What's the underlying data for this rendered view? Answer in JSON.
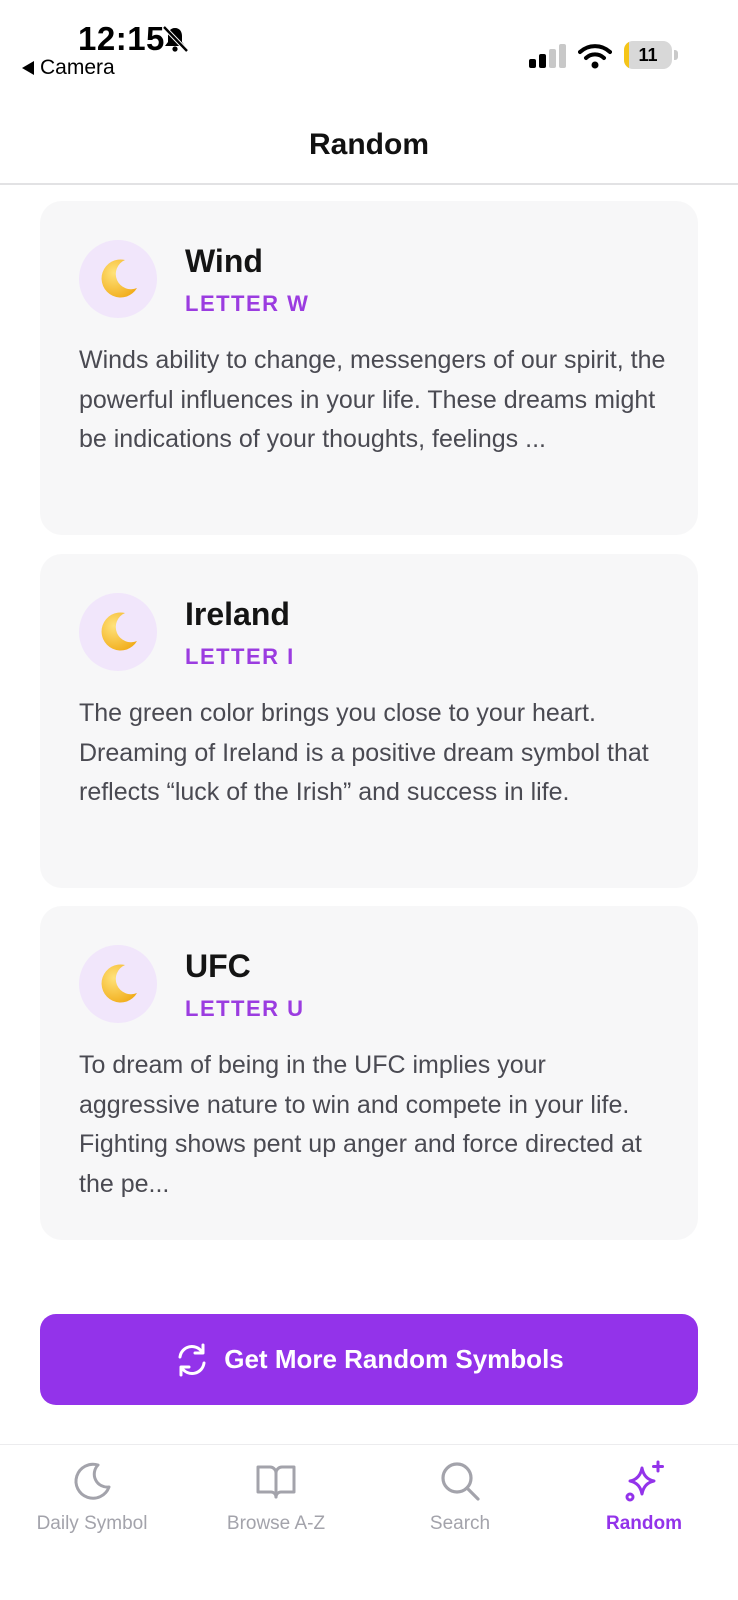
{
  "status": {
    "time": "12:15",
    "back_label": "Camera",
    "battery_text": "11",
    "battery_level": 0.11
  },
  "header": {
    "title": "Random"
  },
  "cards": [
    {
      "title": "Wind",
      "letter": "LETTER W",
      "description": "Winds ability to change, messengers of our spirit, the powerful influences in your life. These dreams might be indications of your thoughts, feelings ...",
      "icon": "crescent-moon-icon"
    },
    {
      "title": "Ireland",
      "letter": "LETTER I",
      "description": "The green color brings you close to your heart. Dreaming of Ireland is a positive dream symbol that reflects “luck of the Irish” and success in life.",
      "icon": "crescent-moon-icon"
    },
    {
      "title": "UFC",
      "letter": "LETTER U",
      "description": "To dream of being in the UFC implies your aggressive nature to win and compete in your life. Fighting shows pent up anger and force directed at the pe...",
      "icon": "crescent-moon-icon"
    }
  ],
  "cta": {
    "label": "Get More Random Symbols",
    "icon": "refresh-icon"
  },
  "tabbar": {
    "active": "Random",
    "items": [
      {
        "label": "Daily Symbol",
        "icon": "moon-icon"
      },
      {
        "label": "Browse A-Z",
        "icon": "book-icon"
      },
      {
        "label": "Search",
        "icon": "search-icon"
      },
      {
        "label": "Random",
        "icon": "sparkles-icon"
      }
    ]
  },
  "colors": {
    "accent": "#9333ea",
    "letter": "#9b3ce0",
    "card_bg": "#f7f7f8",
    "icon_bg": "#f1e6fb",
    "inactive_tab": "#a3a3ab"
  }
}
